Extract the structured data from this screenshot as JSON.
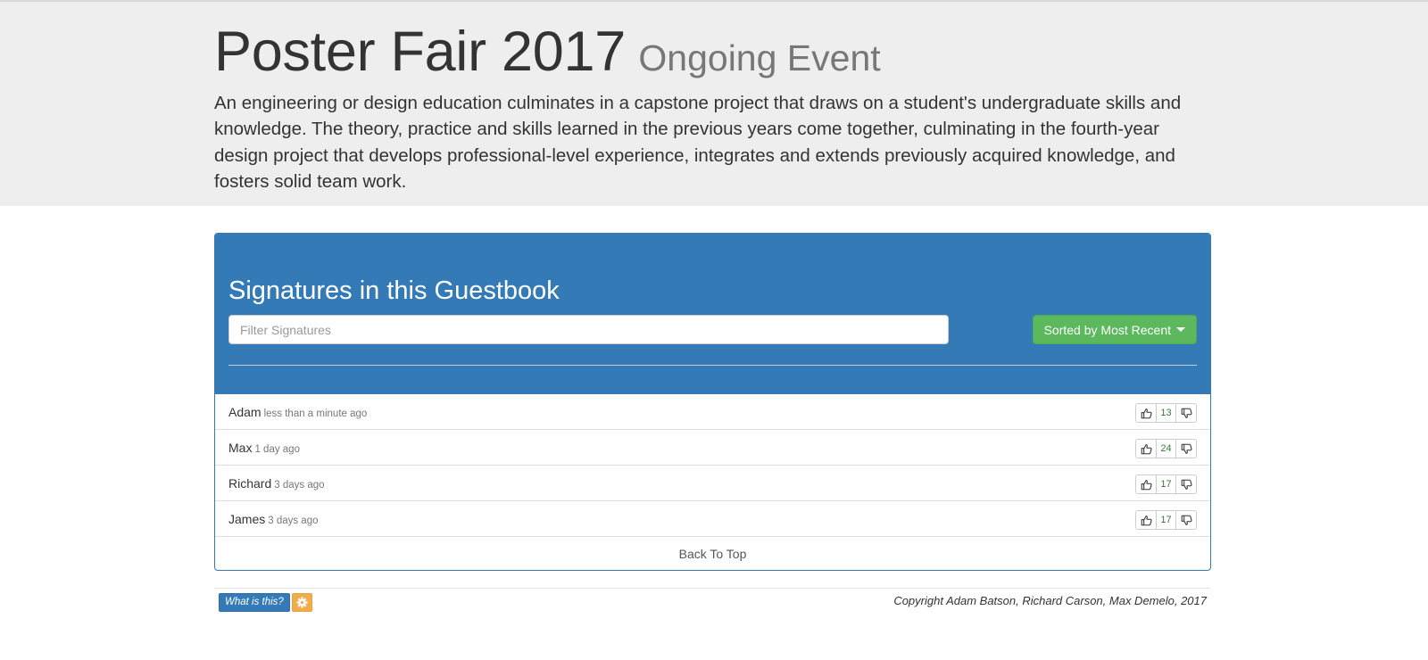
{
  "header": {
    "title": "Poster Fair 2017",
    "subtitle": "Ongoing Event",
    "description": "An engineering or design education culminates in a capstone project that draws on a student's undergraduate skills and knowledge. The theory, practice and skills learned in the previous years come together, culminating in the fourth-year design project that develops professional-level experience, integrates and extends previously acquired knowledge, and fosters solid team work."
  },
  "guestbook": {
    "title": "Signatures in this Guestbook",
    "filter_placeholder": "Filter Signatures",
    "filter_value": "",
    "sort_label": "Sorted by Most Recent",
    "entries": [
      {
        "name": "Adam",
        "time": "less than a minute ago",
        "votes": "13"
      },
      {
        "name": "Max",
        "time": "1 day ago",
        "votes": "24"
      },
      {
        "name": "Richard",
        "time": "3 days ago",
        "votes": "17"
      },
      {
        "name": "James",
        "time": "3 days ago",
        "votes": "17"
      }
    ],
    "back_to_top": "Back To Top"
  },
  "footer": {
    "what_label": "What is this?",
    "settings_icon": "gear-icon",
    "copyright": "Copyright Adam Batson, Richard Carson, Max Demelo, 2017"
  },
  "colors": {
    "primary": "#337ab7",
    "success": "#5cb85c",
    "warning": "#f0ad4e",
    "jumbotron_bg": "#eeeeee",
    "vote_count": "#3c763d"
  }
}
